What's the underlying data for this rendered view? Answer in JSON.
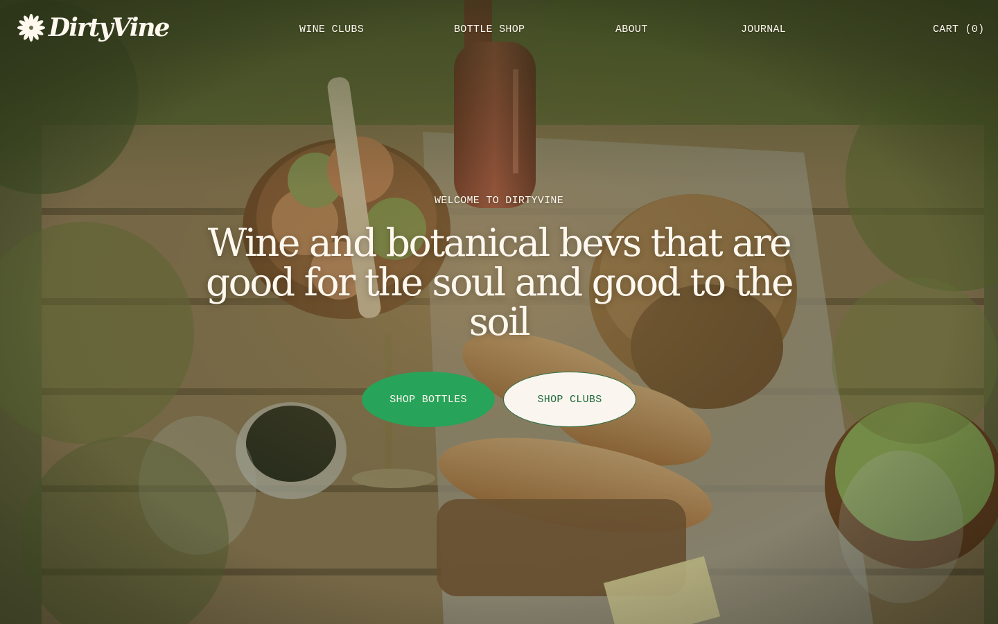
{
  "brand": {
    "name": "DirtyVine",
    "logo_icon": "sunburst-icon"
  },
  "nav": {
    "items": [
      {
        "label": "WINE CLUBS"
      },
      {
        "label": "BOTTLE SHOP"
      },
      {
        "label": "ABOUT"
      },
      {
        "label": "JOURNAL"
      }
    ],
    "cart_label": "CART (0)"
  },
  "hero": {
    "eyebrow": "WELCOME TO DIRTYVINE",
    "headline": "Wine and botanical bevs that are good for the soul and good to the soil",
    "primary_button": "SHOP BOTTLES",
    "secondary_button": "SHOP CLUBS",
    "background_description_icon": "picnic-table-photo"
  },
  "colors": {
    "primary_green": "#27a35a",
    "cream": "#faf5ee",
    "dark_green_text": "#1f6a3c"
  }
}
